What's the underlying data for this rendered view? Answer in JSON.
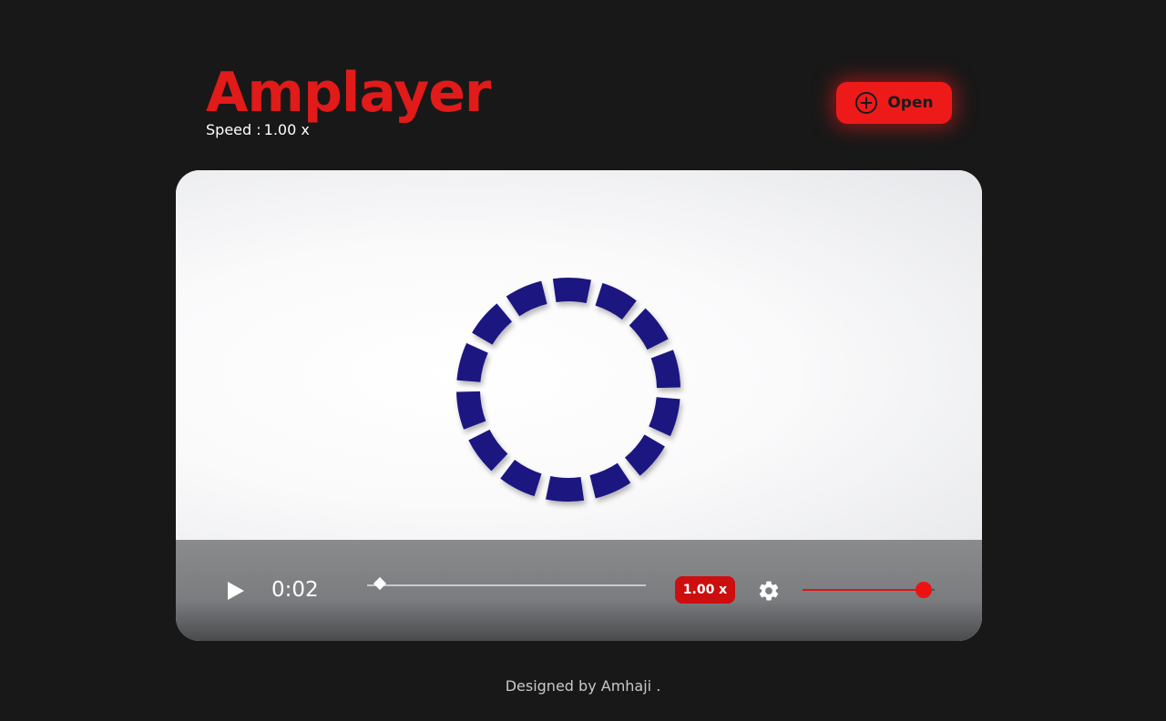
{
  "app": {
    "title": "Amplayer"
  },
  "header": {
    "speed_label": "Speed :",
    "speed_value": "1.00 x",
    "open_button_label": "Open",
    "open_icon": "plus-circle-icon"
  },
  "player": {
    "current_time": "0:02",
    "progress": 0.02,
    "speed_badge": "1.00 x",
    "volume": 0.92,
    "play_icon": "play-icon",
    "settings_icon": "gear-icon"
  },
  "footer": {
    "text": "Designed by Amhaji ."
  },
  "colors": {
    "accent": "#e11a1a",
    "background": "#181818",
    "ring": "#1c1680"
  }
}
